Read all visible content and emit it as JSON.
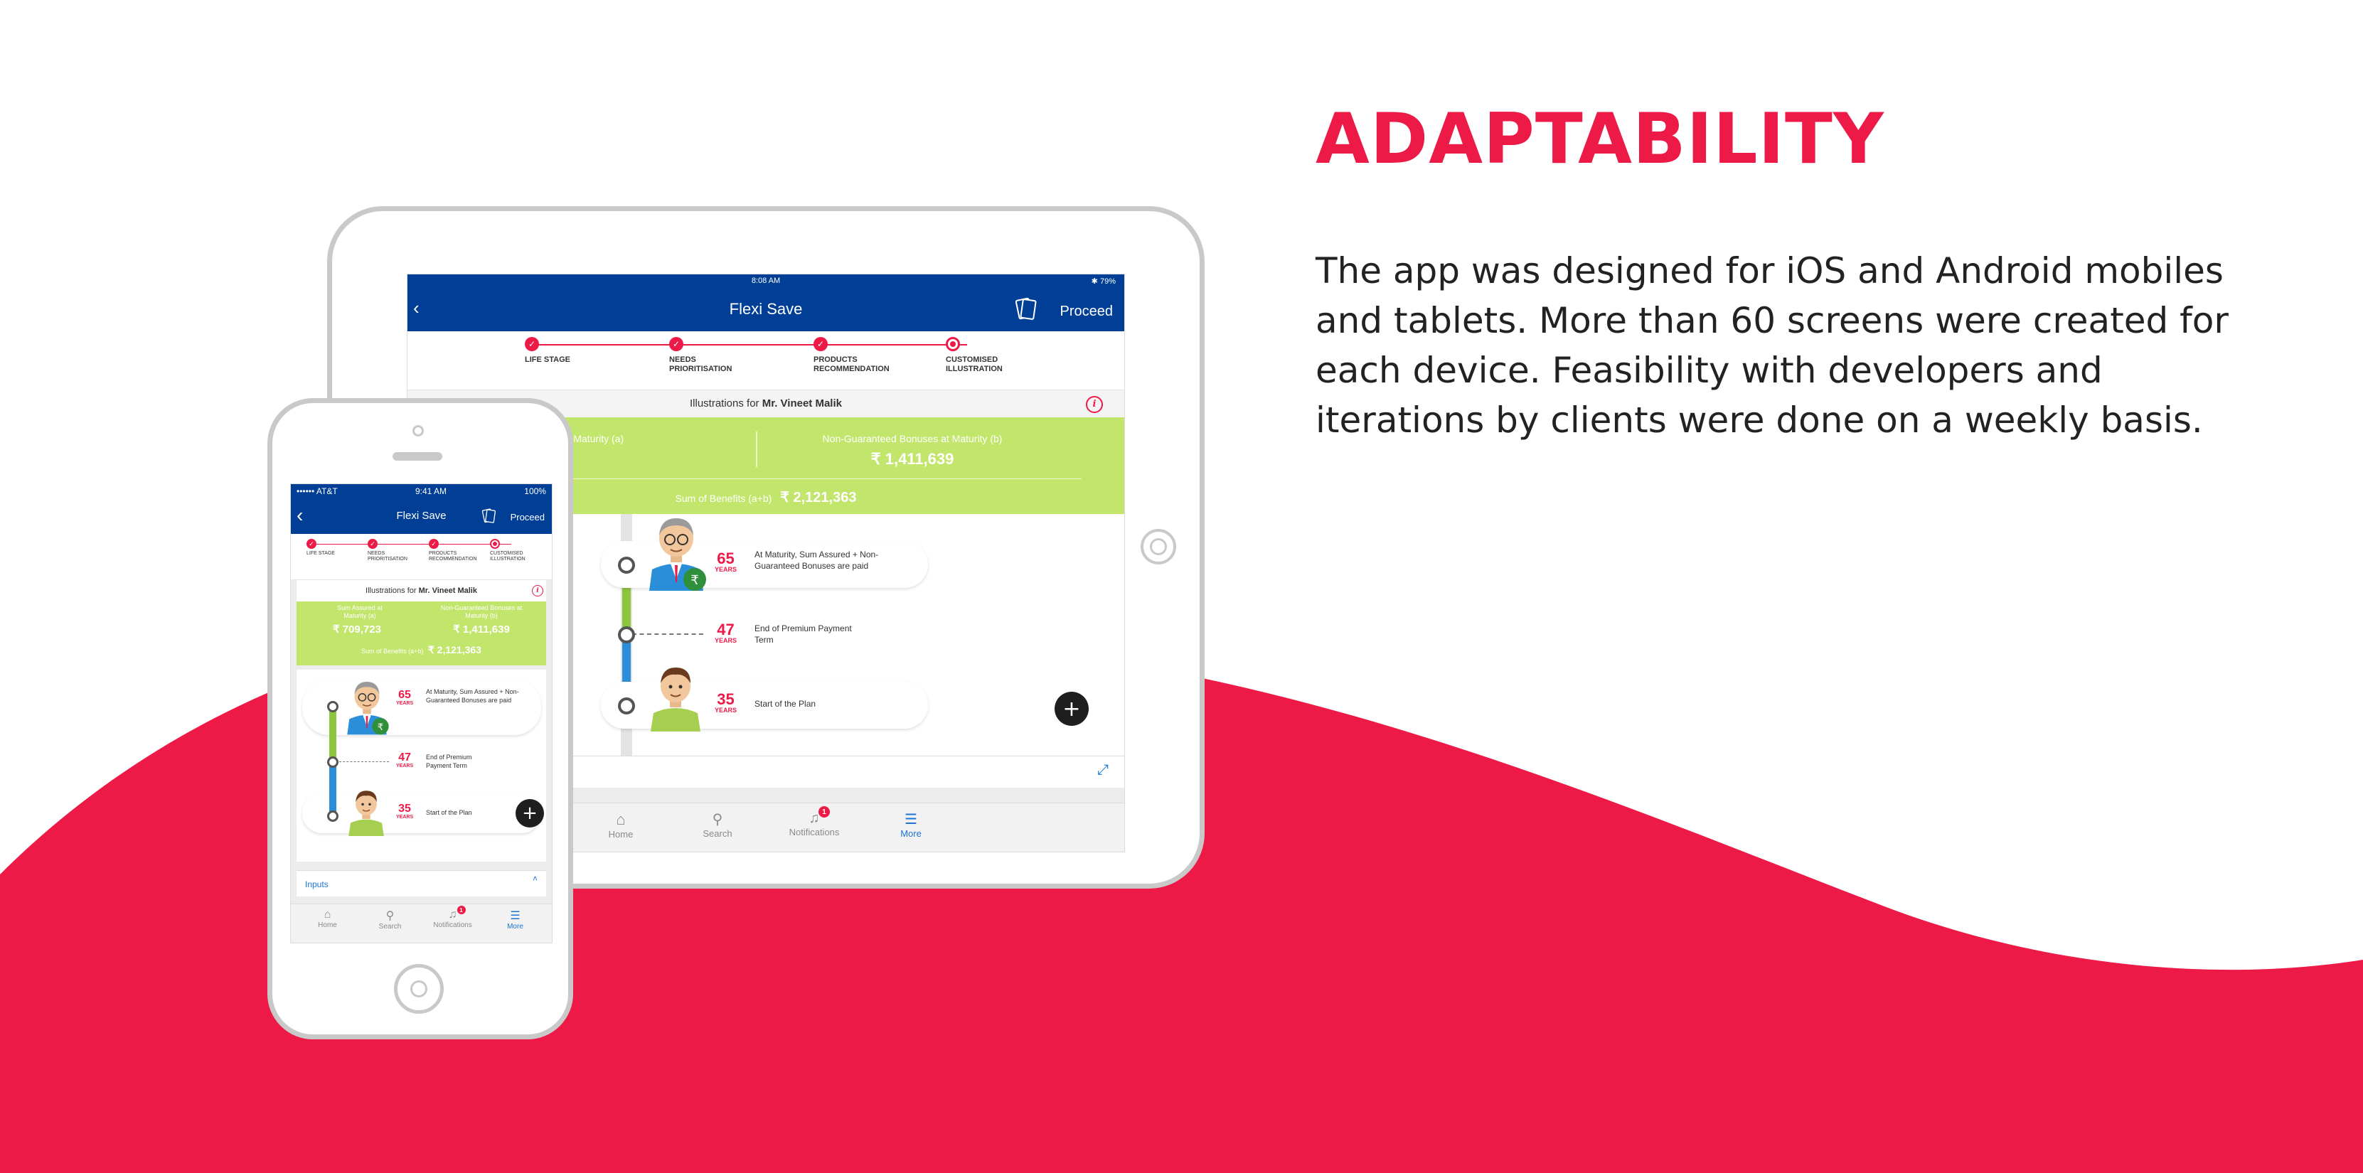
{
  "colors": {
    "accent": "#ed1a48",
    "appbar": "#003f95",
    "green": "#c2e56b",
    "timeline_green": "#8cc63f",
    "timeline_blue": "#2a8fd8"
  },
  "hero": {
    "title": "ADAPTABILITY",
    "body": "The app was designed for iOS and Android mobiles and tablets. More than 60 screens were created for each device. Feasibility with developers and iterations by clients were done on a weekly basis."
  },
  "tablet": {
    "status_time": "8:08 AM",
    "status_battery": "79%",
    "title": "Flexi Save",
    "proceed": "Proceed",
    "steps": [
      {
        "label": "LIFE STAGE"
      },
      {
        "label": "NEEDS PRIORITISATION"
      },
      {
        "label": "PRODUCTS RECOMMENDATION"
      },
      {
        "label": "CUSTOMISED ILLUSTRATION"
      }
    ],
    "illustration_prefix": "Illustrations for",
    "illustration_name": "Mr. Vineet Malik",
    "sum_assured_label": "ured at Maturity (a)",
    "sum_assured_value": "709,723",
    "bonus_label": "Non-Guaranteed Bonuses at Maturity (b)",
    "bonus_value": "₹ 1,411,639",
    "total_label": "Sum of Benefits (a+b)",
    "total_value": "₹ 2,121,363",
    "timeline": [
      {
        "age": "65",
        "unit": "YEARS",
        "text": "At Maturity, Sum Assured + Non-Guaranteed Bonuses are paid"
      },
      {
        "age": "47",
        "unit": "YEARS",
        "text": "End of Premium Payment Term"
      },
      {
        "age": "35",
        "unit": "YEARS",
        "text": "Start of the Plan"
      }
    ],
    "tabs": [
      {
        "label": "Home"
      },
      {
        "label": "Search"
      },
      {
        "label": "Notifications",
        "badge": "1"
      },
      {
        "label": "More"
      }
    ]
  },
  "phone": {
    "carrier": "•••••• AT&T",
    "status_time": "9:41 AM",
    "status_battery": "100%",
    "title": "Flexi Save",
    "proceed": "Proceed",
    "steps": [
      {
        "label": "LIFE STAGE"
      },
      {
        "label": "NEEDS PRIORITISATION"
      },
      {
        "label": "PRODUCTS RECOMMENDATION"
      },
      {
        "label": "CUSTOMISED ILLUSTRATION"
      }
    ],
    "illustration_prefix": "Illustrations for",
    "illustration_name": "Mr. Vineet Malik",
    "sum_assured_label": "Sum Assured at Maturity (a)",
    "sum_assured_value": "₹ 709,723",
    "bonus_label": "Non-Guaranteed Bonuses at Maturity (b)",
    "bonus_value": "₹ 1,411,639",
    "total_label": "Sum of Benefits (a+b)",
    "total_value": "₹ 2,121,363",
    "timeline": [
      {
        "age": "65",
        "unit": "YEARS",
        "text": "At Maturity, Sum Assured + Non-Guaranteed Bonuses are paid"
      },
      {
        "age": "47",
        "unit": "YEARS",
        "text": "End of Premium Payment Term"
      },
      {
        "age": "35",
        "unit": "YEARS",
        "text": "Start of the Plan"
      }
    ],
    "inputs_label": "Inputs",
    "tabs": [
      {
        "label": "Home"
      },
      {
        "label": "Search"
      },
      {
        "label": "Notifications",
        "badge": "1"
      },
      {
        "label": "More"
      }
    ]
  }
}
